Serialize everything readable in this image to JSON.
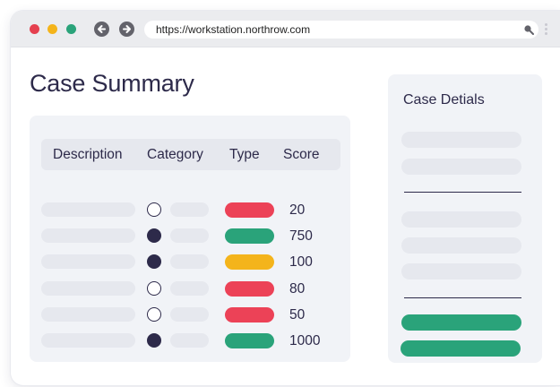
{
  "browser": {
    "url": "https://workstation.northrow.com",
    "traffic_lights": [
      "#e5404f",
      "#f4b41b",
      "#2aa37a"
    ]
  },
  "main": {
    "title": "Case Summary",
    "table": {
      "headers": [
        "Description",
        "Category",
        "Type",
        "Score"
      ],
      "rows": [
        {
          "category_marker": "open",
          "type_color": "#ec4257",
          "score": "20"
        },
        {
          "category_marker": "filled",
          "type_color": "#2aa37a",
          "score": "750"
        },
        {
          "category_marker": "filled",
          "type_color": "#f4b41b",
          "score": "100"
        },
        {
          "category_marker": "open",
          "type_color": "#ec4257",
          "score": "80"
        },
        {
          "category_marker": "open",
          "type_color": "#ec4257",
          "score": "50"
        },
        {
          "category_marker": "filled",
          "type_color": "#2aa37a",
          "score": "1000"
        }
      ]
    }
  },
  "details": {
    "title": "Case Detials",
    "accent_color": "#2aa37a"
  }
}
